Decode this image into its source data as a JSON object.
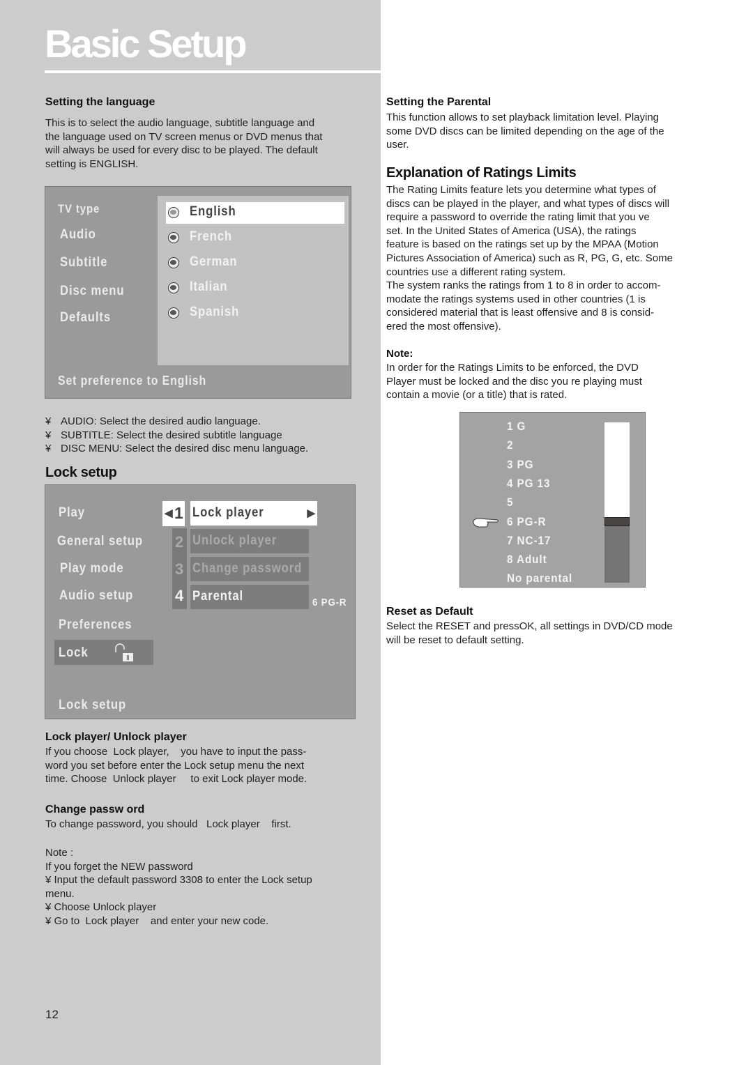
{
  "page": {
    "title": "Basic Setup",
    "page_number": "12"
  },
  "setting_language": {
    "heading": "Setting the language",
    "body": [
      "This is to select the audio language, subtitle language and",
      "the language used on TV screen menus or DVD menus that",
      "will always be used for every disc to be played. The default",
      "setting is ENGLISH."
    ]
  },
  "language_osd": {
    "menu": [
      "TV type",
      "Audio",
      "Subtitle",
      "Disc menu",
      "Defaults"
    ],
    "options": [
      "English",
      "French",
      "German",
      "Italian",
      "Spanish"
    ],
    "selected_option": "English",
    "status": "Set preference to English"
  },
  "language_bullets": {
    "bullet_glyph": "¥",
    "items": [
      "AUDIO: Select the desired audio language.",
      "SUBTITLE: Select the desired subtitle language",
      "DISC MENU: Select the desired disc menu language."
    ]
  },
  "lock_setup": {
    "heading": "Lock setup",
    "osd": {
      "menu": [
        "Play",
        "General setup",
        "Play mode",
        "Audio setup",
        "Preferences",
        "Lock"
      ],
      "selected_menu": "Lock",
      "options": [
        {
          "num": "1",
          "label": "Lock player"
        },
        {
          "num": "2",
          "label": "Unlock player"
        },
        {
          "num": "3",
          "label": "Change password"
        },
        {
          "num": "4",
          "label": "Parental"
        }
      ],
      "parental_value": "6 PG-R",
      "status": "Lock setup",
      "arrow_left": "◀",
      "arrow_right": "▶"
    }
  },
  "lock_player_section": {
    "heading": "Lock player/ Unlock player",
    "body": [
      "If you choose  Lock player,    you have to input the pass-",
      "word you set before enter the Lock setup menu the next",
      "time. Choose  Unlock player     to exit Lock player mode."
    ]
  },
  "change_password_section": {
    "heading": "Change passw ord",
    "body": [
      "To change password, you should   Lock player    first."
    ],
    "note_label": "Note  :",
    "note_lines": [
      "If you forget the NEW password",
      "¥ Input the default password 3308 to enter the Lock setup",
      "menu.",
      "¥ Choose Unlock player",
      "¥ Go to  Lock player    and enter your new code."
    ]
  },
  "setting_parental": {
    "heading": "Setting the Parental",
    "body": [
      "This function allows to set playback limitation level. Playing",
      "some DVD discs can be limited depending on the age of the",
      "user."
    ]
  },
  "ratings_explanation": {
    "heading": "Explanation of Ratings Limits",
    "body": [
      "The Rating Limits feature lets you determine what types of",
      "discs can be played in the player, and what types of discs will",
      "require a password to override the rating limit that you ve",
      "set. In the United States of America (USA), the ratings",
      "feature is based on the ratings set up by the MPAA (Motion",
      "Pictures Association of America) such as R, PG, G, etc. Some",
      "countries use a different rating system.",
      "The system ranks the ratings from 1 to 8 in order to accom-",
      "modate the ratings systems used in other countries (1 is",
      "considered material that is least offensive and 8 is consid-",
      "ered the most offensive)."
    ],
    "note_label": "Note:",
    "note_body": [
      "In order for the Ratings Limits to be enforced, the DVD",
      "Player must be locked and the disc you re playing must",
      "contain a movie (or a title) that is rated."
    ]
  },
  "ratings_osd": {
    "levels": [
      "1 G",
      "2",
      "3 PG",
      "4 PG 13",
      "5",
      "6 PG-R",
      "7 NC-17",
      "8 Adult",
      "No parental"
    ],
    "selected_index": 5,
    "selected_level": "6 PG-R",
    "pointer_icon": "pointing-hand"
  },
  "reset_section": {
    "heading": "Reset as Default",
    "body": [
      "Select the RESET and pressOK, all settings in DVD/CD mode",
      "will be reset to default setting."
    ]
  }
}
